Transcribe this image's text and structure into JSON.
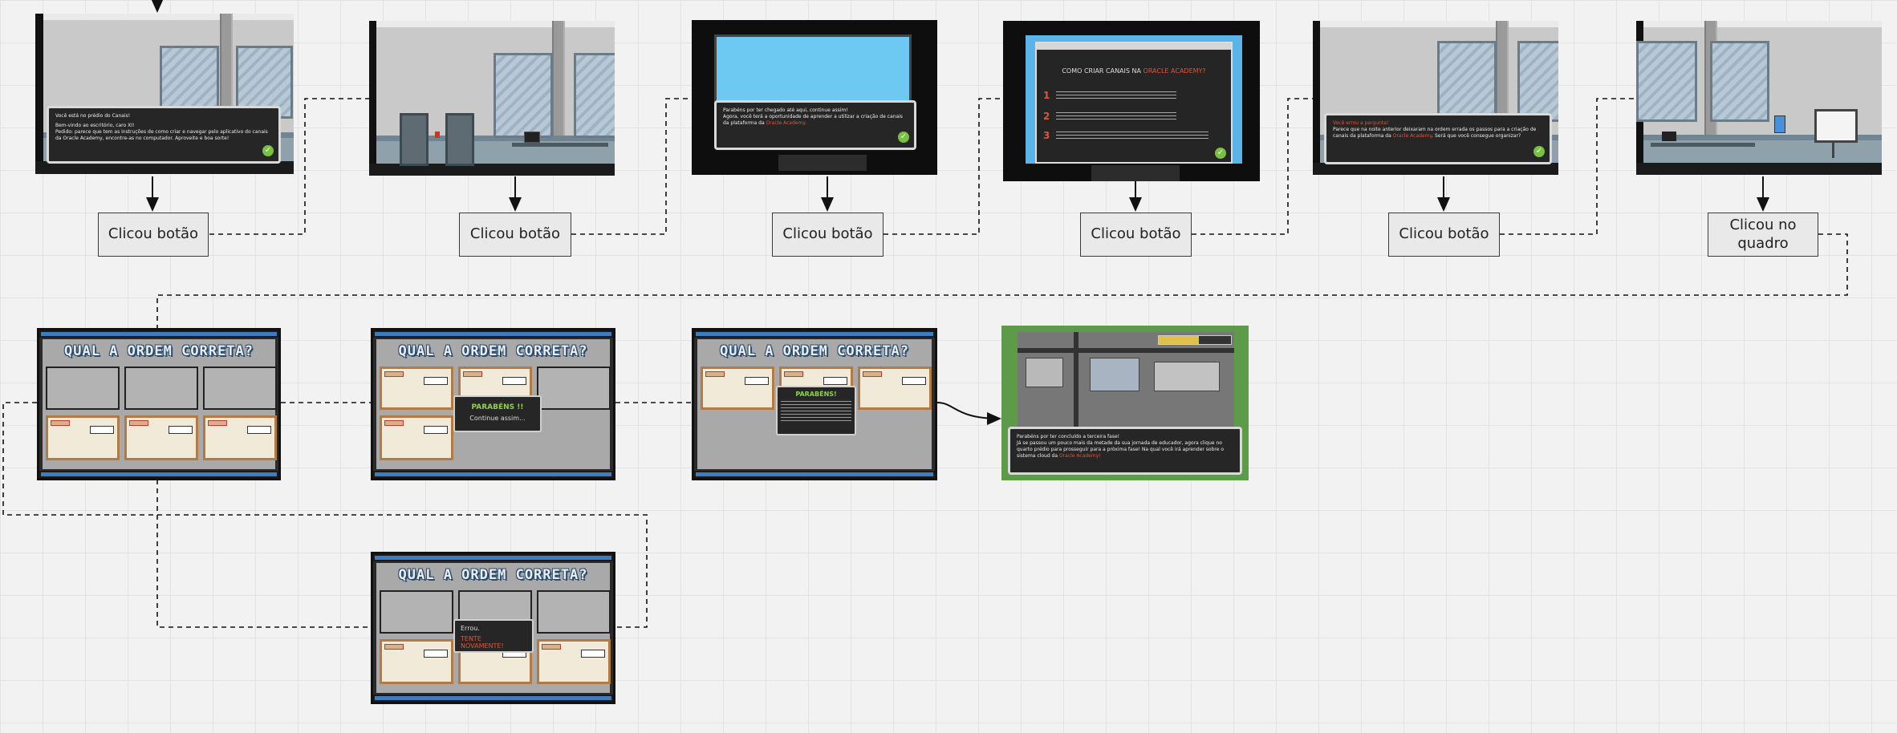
{
  "flow": {
    "step_labels": [
      "Clicou botão",
      "Clicou botão",
      "Clicou botão",
      "Clicou botão",
      "Clicou botão",
      "Clicou no quadro"
    ]
  },
  "screens": {
    "s1": {
      "lines": [
        "Você está no prédio do Canais!",
        "Bem-vindo ao escritório, caro XI!",
        "Pedido: parece que tem as instruções de como criar e navegar pelo aplicativo do canais da Oracle Academy, encontre-as no computador. Aproveite e boa sorte!"
      ]
    },
    "s3": {
      "lines": [
        "Parabéns por ter chegado até aqui, continue assim!",
        "Agora, você terá a oportunidade de aprender a utilizar a criação de canais da plataforma da"
      ],
      "highlight": "Oracle Academy."
    },
    "s4": {
      "heading": "COMO CRIAR CANAIS NA",
      "heading_highlight": "ORACLE ACADEMY?",
      "numbers": [
        "1",
        "2",
        "3"
      ]
    },
    "s5": {
      "title": "Você errou a pergunta!",
      "lines": [
        "Parece que na noite anterior deixaram na ordem errada os passos para a criação de canais da plataforma da"
      ],
      "highlight": "Oracle Academy",
      "tail": ". Será que você consegue organizar?"
    }
  },
  "quiz": {
    "title": "QUAL A ORDEM CORRETA?",
    "success_popup": {
      "title": "PARABÉNS !!",
      "subtitle": "Continue assim..."
    },
    "final_popup": {
      "title": "PARABÉNS!"
    },
    "error_popup": {
      "title": "Errou.",
      "subtitle": "TENTE NOVAMENTE!"
    }
  },
  "map_screen": {
    "lines": [
      "Parabéns por ter concluído a terceira fase!",
      "Já se passou um pouco mais da metade da sua jornada de educador, agora clique no quarto prédio para prosseguir para a próxima fase! Na qual você irá aprender sobre o sistema cloud da"
    ],
    "highlight": "Oracle Academy!"
  },
  "colors": {
    "accent_red": "#e0543c",
    "quiz_blue": "#3e7bbf",
    "check_green": "#79c142",
    "dialog_bg": "#262626"
  }
}
